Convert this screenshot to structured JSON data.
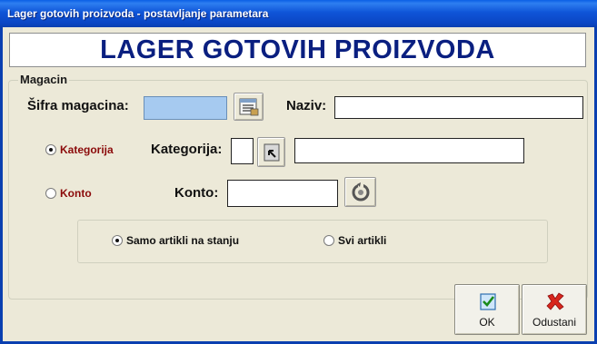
{
  "window": {
    "title": "Lager gotovih proizvoda - postavljanje parametara"
  },
  "banner": {
    "text": "LAGER GOTOVIH PROIZVODA"
  },
  "magacin": {
    "legend": "Magacin",
    "sifra_label": "Šifra magacina:",
    "sifra_value": "",
    "naziv_label": "Naziv:",
    "naziv_value": "",
    "lookup_icon": "list-lookup-icon"
  },
  "filter": {
    "kategorija_radio": "Kategorija",
    "konto_radio": "Konto",
    "kategorija_label": "Kategorija:",
    "kategorija_code": "",
    "kategorija_name": "",
    "kategorija_icon": "arrow-lookup-icon",
    "konto_label": "Konto:",
    "konto_value": "",
    "konto_icon": "refresh-icon",
    "selected": "Kategorija"
  },
  "stock": {
    "option_on_stock": "Samo artikli na stanju",
    "option_all": "Svi artikli",
    "selected": "Samo artikli na stanju"
  },
  "actions": {
    "ok_label": "OK",
    "ok_icon": "checkmark-icon",
    "cancel_label": "Odustani",
    "cancel_icon": "red-x-icon"
  }
}
